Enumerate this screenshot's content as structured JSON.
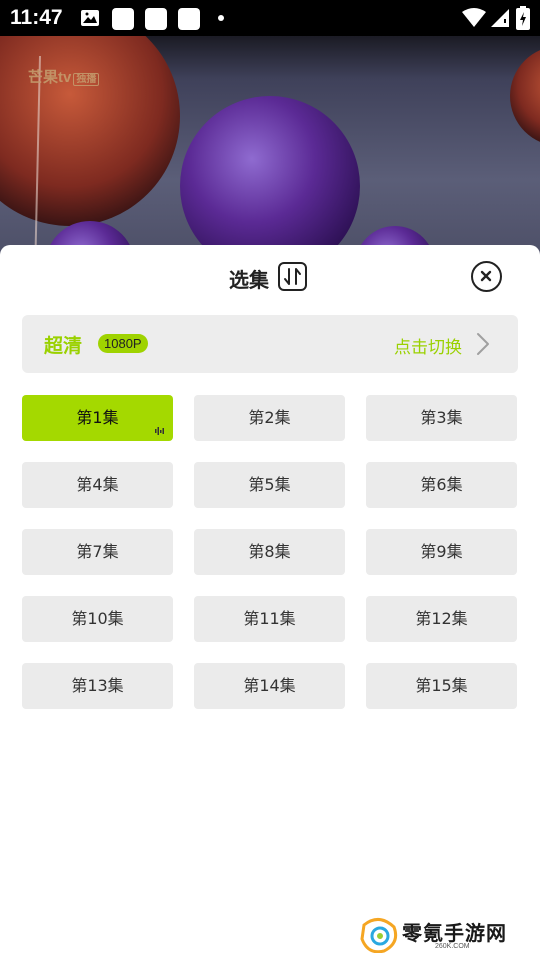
{
  "status_bar": {
    "time": "11:47",
    "icons": [
      "image-icon",
      "app-icon",
      "app-icon",
      "app-icon",
      "dot-icon",
      "wifi-icon",
      "signal-icon",
      "battery-icon"
    ]
  },
  "video": {
    "logo_text": "芒果tv",
    "logo_tag": "独播"
  },
  "sheet": {
    "title": "选集",
    "quality": {
      "label": "超清",
      "badge": "1080P",
      "switch_label": "点击切换"
    },
    "episodes": [
      {
        "label": "第1集",
        "active": true
      },
      {
        "label": "第2集",
        "active": false
      },
      {
        "label": "第3集",
        "active": false
      },
      {
        "label": "第4集",
        "active": false
      },
      {
        "label": "第5集",
        "active": false
      },
      {
        "label": "第6集",
        "active": false
      },
      {
        "label": "第7集",
        "active": false
      },
      {
        "label": "第8集",
        "active": false
      },
      {
        "label": "第9集",
        "active": false
      },
      {
        "label": "第10集",
        "active": false
      },
      {
        "label": "第11集",
        "active": false
      },
      {
        "label": "第12集",
        "active": false
      },
      {
        "label": "第13集",
        "active": false
      },
      {
        "label": "第14集",
        "active": false
      },
      {
        "label": "第15集",
        "active": false
      }
    ]
  },
  "watermark": {
    "name": "零氪手游网",
    "domain": "260K.COM"
  },
  "colors": {
    "accent": "#a4d900",
    "accent_text": "#9ad100",
    "tile_bg": "#ebebeb"
  }
}
